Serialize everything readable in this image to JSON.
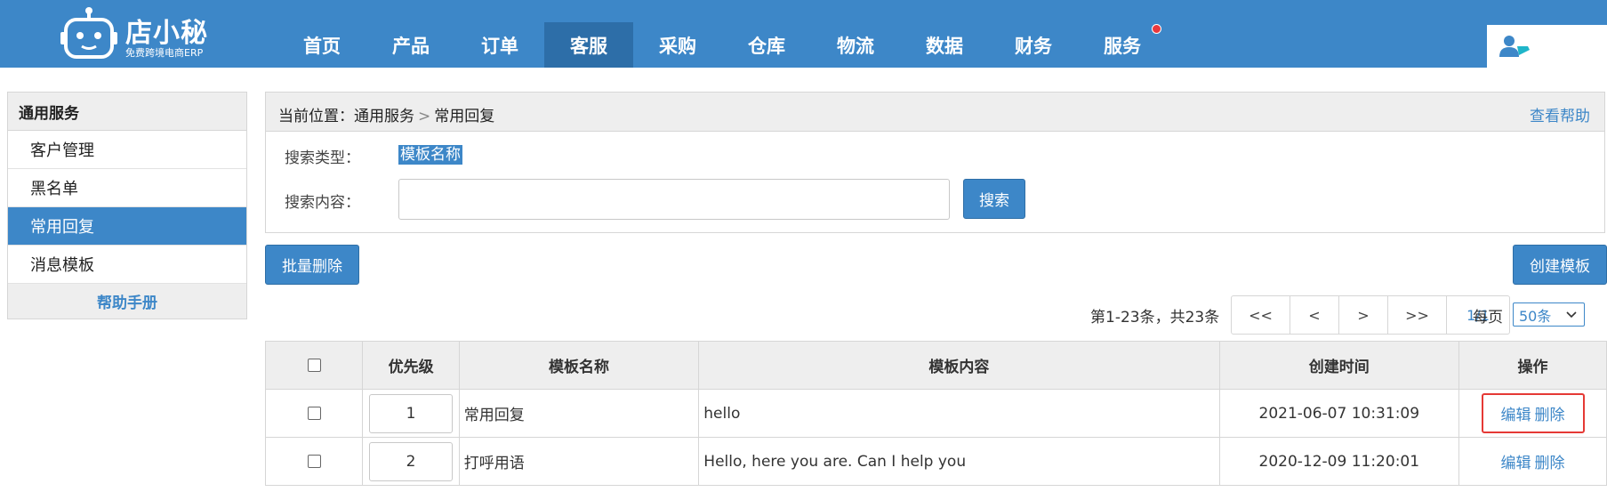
{
  "logo": {
    "title": "店小秘",
    "subtitle": "免费跨境电商ERP"
  },
  "nav": {
    "items": [
      "首页",
      "产品",
      "订单",
      "客服",
      "采购",
      "仓库",
      "物流",
      "数据",
      "财务",
      "服务"
    ],
    "active": "客服"
  },
  "sidebar": {
    "header": "通用服务",
    "items": [
      "客户管理",
      "黑名单",
      "常用回复",
      "消息模板"
    ],
    "active": "常用回复",
    "help": "帮助手册"
  },
  "breadcrumb": {
    "prefix": "当前位置：",
    "parent": "通用服务",
    "separator": ">",
    "current": "常用回复"
  },
  "help_link": "查看帮助",
  "search": {
    "type_label": "搜索类型：",
    "type_value": "模板名称",
    "content_label": "搜索内容：",
    "content_value": "",
    "button": "搜索"
  },
  "actions": {
    "batch_delete": "批量删除",
    "create": "创建模板"
  },
  "pagination": {
    "range_text": "第1-23条，共23条",
    "first": "<<",
    "prev": "<",
    "next": ">",
    "last": ">>",
    "page": "1/1",
    "per_page_label": "每页",
    "per_page_value": "50条"
  },
  "table": {
    "headers": [
      "",
      "优先级",
      "模板名称",
      "模板内容",
      "创建时间",
      "操作"
    ],
    "rows": [
      {
        "priority": "1",
        "name": "常用回复",
        "content": "hello",
        "created": "2021-06-07 10:31:09",
        "edit": "编辑",
        "delete": "删除"
      },
      {
        "priority": "2",
        "name": "打呼用语",
        "content": "Hello, here you are. Can I help you",
        "created": "2020-12-09 11:20:01",
        "edit": "编辑",
        "delete": "删除"
      }
    ]
  },
  "colors": {
    "primary": "#3d87c8",
    "nav_active": "#2d6ea8",
    "highlight_border": "#e53935",
    "notice_dot": "#e8383d"
  }
}
